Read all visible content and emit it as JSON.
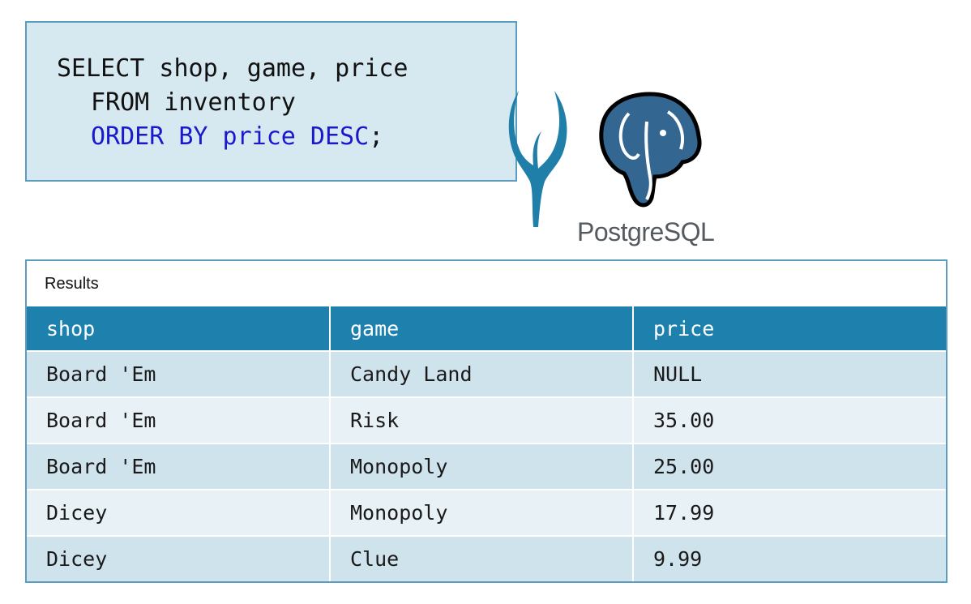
{
  "query": {
    "line1": "SELECT shop, game, price",
    "line2": "FROM inventory",
    "line3_main": "ORDER BY price DESC",
    "line3_end": ";",
    "keyword_color": "#1a1acc"
  },
  "logos": {
    "antelope_icon": "antelope-icon",
    "postgres_icon": "elephant-icon",
    "postgres_wordmark": "PostgreSQL"
  },
  "results": {
    "title": "Results",
    "columns": [
      "shop",
      "game",
      "price"
    ],
    "rows": [
      [
        "Board 'Em",
        "Candy Land",
        "NULL"
      ],
      [
        "Board 'Em",
        "Risk",
        "35.00"
      ],
      [
        "Board 'Em",
        "Monopoly",
        "25.00"
      ],
      [
        "Dicey",
        "Monopoly",
        "17.99"
      ],
      [
        "Dicey",
        "Clue",
        "9.99"
      ]
    ]
  },
  "colors": {
    "header_bg": "#1e80ad",
    "query_bg": "#d6e8f0",
    "border": "#5c9dbd"
  }
}
